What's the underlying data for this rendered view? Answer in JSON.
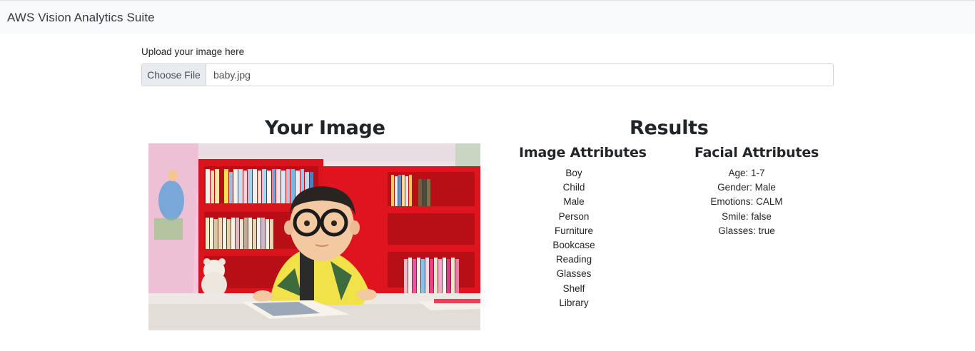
{
  "navbar": {
    "brand": "AWS Vision Analytics Suite"
  },
  "upload": {
    "label": "Upload your image here",
    "button_label": "Choose File",
    "file_name": "baby.jpg"
  },
  "image_section": {
    "heading": "Your Image"
  },
  "results": {
    "heading": "Results",
    "image_attributes": {
      "heading": "Image Attributes",
      "items": [
        "Boy",
        "Child",
        "Male",
        "Person",
        "Furniture",
        "Bookcase",
        "Reading",
        "Glasses",
        "Shelf",
        "Library"
      ]
    },
    "facial_attributes": {
      "heading": "Facial Attributes",
      "items": [
        "Age: 1-7",
        "Gender: Male",
        "Emotions: CALM",
        "Smile: false",
        "Glasses: true"
      ]
    }
  },
  "colors": {
    "navbar_bg": "#f8f9fa",
    "shelf_red": "#d9141c",
    "input_border": "#ced4da"
  }
}
